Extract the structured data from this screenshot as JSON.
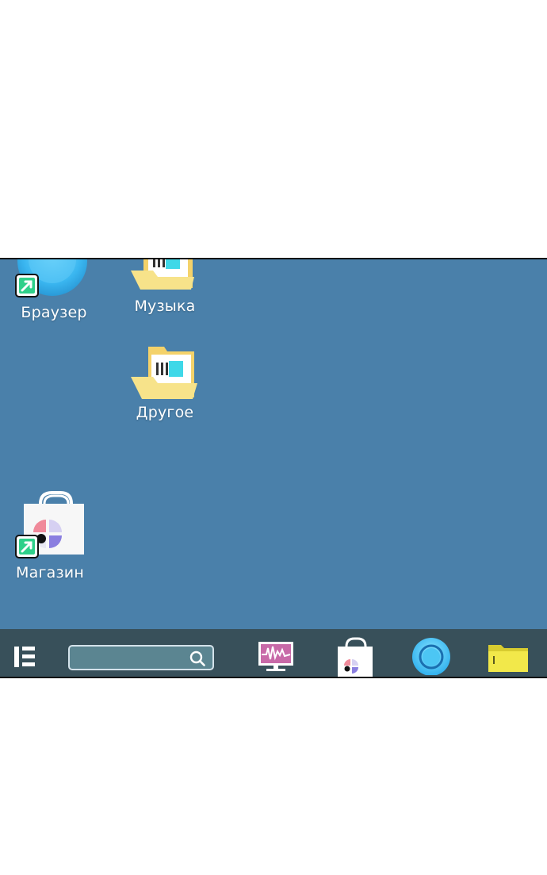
{
  "desktop": {
    "background_color": "#4a80aa",
    "icons": [
      {
        "label": "Браузер",
        "icon": "browser-shortcut-icon"
      },
      {
        "label": "Музыка",
        "icon": "folder-icon"
      },
      {
        "label": "Другое",
        "icon": "folder-icon"
      },
      {
        "label": "Магазин",
        "icon": "store-shortcut-icon"
      }
    ]
  },
  "taskbar": {
    "background_color": "#38505a",
    "start_icon": "start-menu-icon",
    "search": {
      "value": "",
      "placeholder": "",
      "icon": "search-icon"
    },
    "pinned": [
      {
        "icon": "system-monitor-icon"
      },
      {
        "icon": "store-icon"
      },
      {
        "icon": "browser-icon"
      },
      {
        "icon": "file-manager-icon"
      }
    ]
  }
}
